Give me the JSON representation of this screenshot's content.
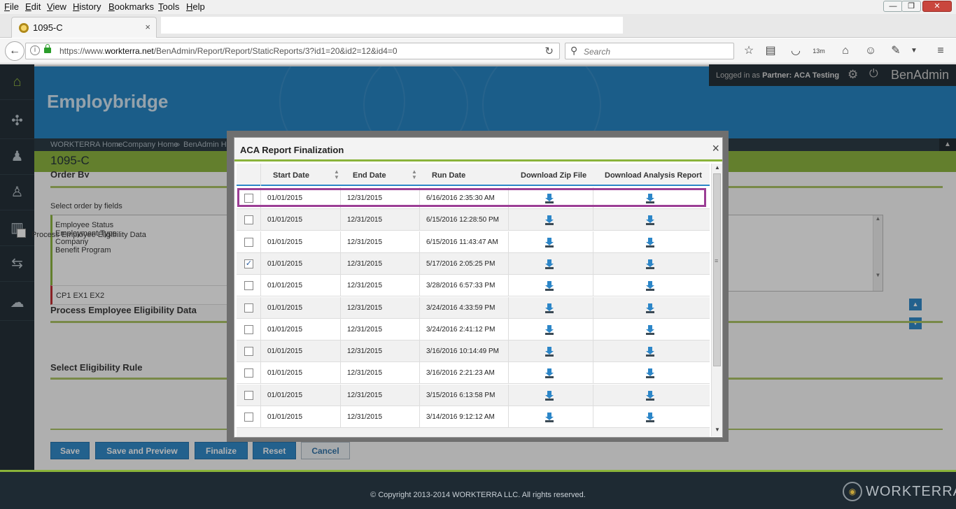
{
  "browser": {
    "menus": [
      "File",
      "Edit",
      "View",
      "History",
      "Bookmarks",
      "Tools",
      "Help"
    ],
    "window_controls": {
      "minimize": "—",
      "maximize": "❐",
      "close": "✕"
    },
    "tab": {
      "title": "1095-C",
      "close": "×"
    },
    "url": {
      "prefix": "https://www.",
      "domain": "workterra.net",
      "path": "/BenAdmin/Report/Report/StaticReports/3?id1=20&id2=12&id4=0"
    },
    "search_placeholder": "Search",
    "badge_13m": "13m"
  },
  "header": {
    "app_title": "Employbridge",
    "logged_in_prefix": "Logged in as",
    "partner_label": "Partner:",
    "partner_name": "ACA Testing",
    "product": "BenAdmin"
  },
  "breadcrumb": [
    "WORKTERRA Home",
    "Company Home",
    "BenAdmin Home"
  ],
  "breadcrumb_separator": "»",
  "page": {
    "title": "1095-C",
    "order_by_heading": "Order By",
    "select_order_label": "Select order by fields",
    "order_fields": [
      "Employee Status",
      "Employment Type",
      "Company",
      "Benefit Program"
    ],
    "process_heading": "Process Employee Eligibility Data",
    "process_checkbox_label": "Process Employee Eligibility Data",
    "rule_heading": "Select Eligibility Rule",
    "rule_value": "CP1 EX1 EX2"
  },
  "buttons": {
    "save": "Save",
    "save_preview": "Save and Preview",
    "finalize": "Finalize",
    "reset": "Reset",
    "cancel": "Cancel"
  },
  "footer": {
    "copyright": "© Copyright 2013-2014 WORKTERRA LLC. All rights reserved.",
    "logo": "WORKTERRA"
  },
  "modal": {
    "title": "ACA Report Finalization",
    "close": "×",
    "columns": [
      "Start Date",
      "End Date",
      "Run Date",
      "Download Zip File",
      "Download Analysis Report"
    ],
    "rows": [
      {
        "checked": false,
        "start": "01/01/2015",
        "end": "12/31/2015",
        "run": "6/16/2016 2:35:30 AM"
      },
      {
        "checked": false,
        "start": "01/01/2015",
        "end": "12/31/2015",
        "run": "6/15/2016 12:28:50 PM"
      },
      {
        "checked": false,
        "start": "01/01/2015",
        "end": "12/31/2015",
        "run": "6/15/2016 11:43:47 AM"
      },
      {
        "checked": true,
        "start": "01/01/2015",
        "end": "12/31/2015",
        "run": "5/17/2016 2:05:25 PM"
      },
      {
        "checked": false,
        "start": "01/01/2015",
        "end": "12/31/2015",
        "run": "3/28/2016 6:57:33 PM"
      },
      {
        "checked": false,
        "start": "01/01/2015",
        "end": "12/31/2015",
        "run": "3/24/2016 4:33:59 PM"
      },
      {
        "checked": false,
        "start": "01/01/2015",
        "end": "12/31/2015",
        "run": "3/24/2016 2:41:12 PM"
      },
      {
        "checked": false,
        "start": "01/01/2015",
        "end": "12/31/2015",
        "run": "3/16/2016 10:14:49 PM"
      },
      {
        "checked": false,
        "start": "01/01/2015",
        "end": "12/31/2015",
        "run": "3/16/2016 2:21:23 AM"
      },
      {
        "checked": false,
        "start": "01/01/2015",
        "end": "12/31/2015",
        "run": "3/15/2016 6:13:58 PM"
      },
      {
        "checked": false,
        "start": "01/01/2015",
        "end": "12/31/2015",
        "run": "3/14/2016 9:12:12 AM"
      }
    ]
  },
  "colors": {
    "accent_green": "#8ab33a",
    "banner_blue": "#2081c2",
    "nav_dark": "#1e2a33",
    "button_blue": "#2c86c8",
    "highlight_purple": "#9b3e95"
  }
}
